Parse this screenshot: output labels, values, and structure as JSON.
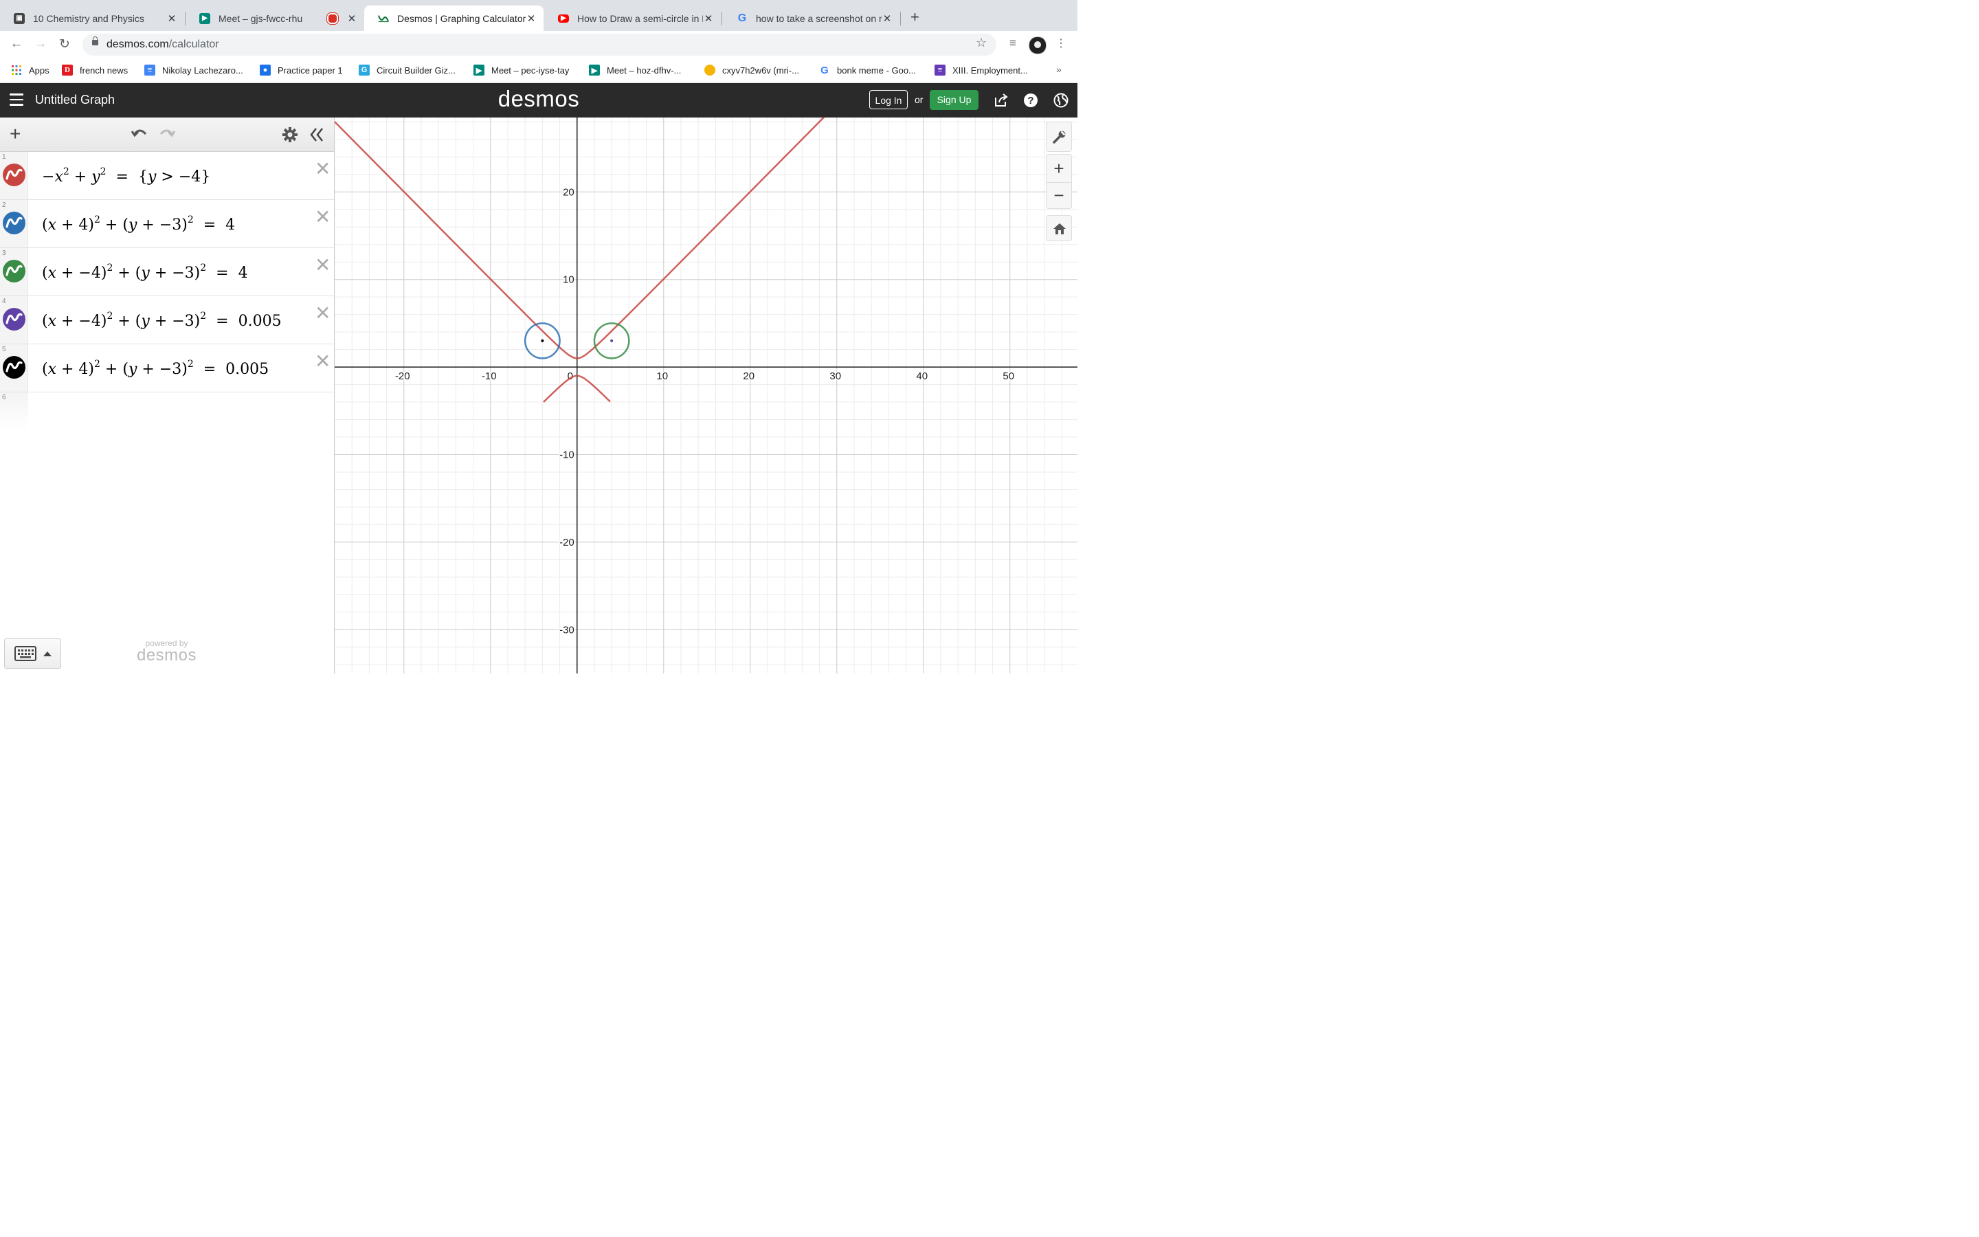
{
  "browser": {
    "tabs": [
      {
        "title": "10 Chemistry and Physics",
        "icon": "classroom-icon",
        "active": false
      },
      {
        "title": "Meet – gjs-fwcc-rhu",
        "icon": "meet-icon",
        "active": false
      },
      {
        "title": "Desmos | Graphing Calculator",
        "icon": "desmos-icon",
        "active": true
      },
      {
        "title": "How to Draw a semi-circle in D",
        "icon": "youtube-icon",
        "active": false
      },
      {
        "title": "how to take a screenshot on m",
        "icon": "google-icon",
        "active": false
      }
    ],
    "url_domain": "desmos.com",
    "url_path": "/calculator",
    "bookmarks": [
      {
        "label": "Apps",
        "icon": "apps-grid-icon"
      },
      {
        "label": "french news",
        "icon": "news-icon"
      },
      {
        "label": "Nikolay Lachezaro...",
        "icon": "docs-icon"
      },
      {
        "label": "Practice paper 1",
        "icon": "contact-icon"
      },
      {
        "label": "Circuit Builder Giz...",
        "icon": "gizmo-icon"
      },
      {
        "label": "Meet – pec-iyse-tay",
        "icon": "meet-icon"
      },
      {
        "label": "Meet – hoz-dfhv-...",
        "icon": "meet-icon"
      },
      {
        "label": "cxyv7h2w6v (mri-...",
        "icon": "hand-icon"
      },
      {
        "label": "bonk meme - Goo...",
        "icon": "google-icon"
      },
      {
        "label": "XIII. Employment...",
        "icon": "forms-icon"
      }
    ],
    "bookmarks_more": "»"
  },
  "header": {
    "graph_title": "Untitled Graph",
    "logo": "desmos",
    "login_label": "Log In",
    "or_label": "or",
    "signup_label": "Sign Up"
  },
  "expressions": [
    {
      "num": "1",
      "color": "#c74440",
      "latex": "-x^2+y^2={y>-4}"
    },
    {
      "num": "2",
      "color": "#2d70b3",
      "latex": "(x+4)^2+(y+-3)^2=4"
    },
    {
      "num": "3",
      "color": "#388c46",
      "latex": "(x+-4)^2+(y+-3)^2=4"
    },
    {
      "num": "4",
      "color": "#6042a6",
      "latex": "(x+-4)^2+(y+-3)^2=0.005"
    },
    {
      "num": "5",
      "color": "#000000",
      "latex": "(x+4)^2+(y+-3)^2=0.005"
    }
  ],
  "empty_row_num": "6",
  "powered_by": {
    "small": "powered by",
    "brand": "desmos"
  },
  "graph": {
    "x_ticks": [
      "-20",
      "-10",
      "0",
      "10",
      "20",
      "30",
      "40",
      "50"
    ],
    "y_ticks": [
      "20",
      "10",
      "-10",
      "-20",
      "-30"
    ],
    "xlim": [
      -28,
      57.8
    ],
    "ylim": [
      -35,
      28.5
    ],
    "curve_color": "#c74440"
  },
  "chart_data": {
    "type": "line",
    "xlim": [
      -28,
      57.8
    ],
    "ylim": [
      -35,
      28.5
    ],
    "grid": true,
    "series": [
      {
        "equation": "-x^2+y^2=1",
        "color": "#c74440"
      },
      {
        "equation": "(x+4)^2+(y-3)^2=4",
        "color": "#2d70b3"
      },
      {
        "equation": "(x-4)^2+(y-3)^2=4",
        "color": "#388c46"
      },
      {
        "equation": "(x-4)^2+(y-3)^2=0.005",
        "color": "#6042a6"
      },
      {
        "equation": "(x+4)^2+(y-3)^2=0.005",
        "color": "#000000"
      }
    ]
  }
}
